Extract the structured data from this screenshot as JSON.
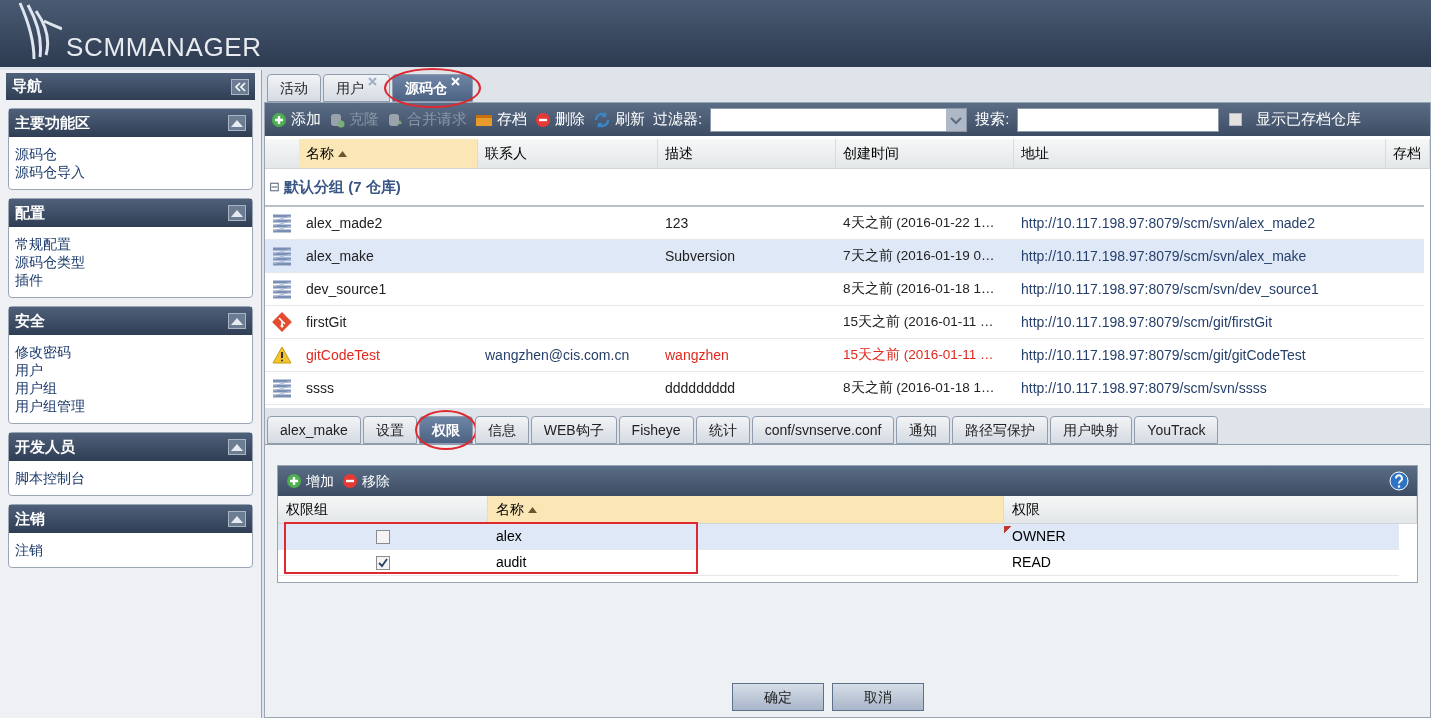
{
  "logo": "SCMMANAGER",
  "nav": {
    "title": "导航",
    "sections": [
      {
        "title": "主要功能区",
        "items": [
          "源码仓",
          "源码仓导入"
        ]
      },
      {
        "title": "配置",
        "items": [
          "常规配置",
          "源码仓类型",
          "插件"
        ]
      },
      {
        "title": "安全",
        "items": [
          "修改密码",
          "用户",
          "用户组",
          "用户组管理"
        ]
      },
      {
        "title": "开发人员",
        "items": [
          "脚本控制台"
        ]
      },
      {
        "title": "注销",
        "items": [
          "注销"
        ]
      }
    ]
  },
  "tabs": [
    {
      "label": "活动",
      "selected": false,
      "closable": false,
      "circled": false
    },
    {
      "label": "用户",
      "selected": false,
      "closable": true,
      "circled": false
    },
    {
      "label": "源码仓",
      "selected": true,
      "closable": true,
      "circled": true
    }
  ],
  "toolbar": {
    "buttons": [
      {
        "label": "添加",
        "kind": "add",
        "disabled": false
      },
      {
        "label": "克隆",
        "kind": "clone",
        "disabled": true
      },
      {
        "label": "合并请求",
        "kind": "merge",
        "disabled": true
      },
      {
        "label": "存档",
        "kind": "archive",
        "disabled": false
      },
      {
        "label": "删除",
        "kind": "delete",
        "disabled": false
      },
      {
        "label": "刷新",
        "kind": "refresh",
        "disabled": false
      }
    ],
    "filter_label": "过滤器:",
    "search_label": "搜索:",
    "show_archived": {
      "label": "显示已存档仓库",
      "checked": false
    }
  },
  "table": {
    "columns": [
      {
        "label": "名称",
        "sorted": true
      },
      {
        "label": "联系人",
        "sorted": false
      },
      {
        "label": "描述",
        "sorted": false
      },
      {
        "label": "创建时间",
        "sorted": false
      },
      {
        "label": "地址",
        "sorted": false
      },
      {
        "label": "存档",
        "sorted": false
      }
    ],
    "group": {
      "symbol": "⊟",
      "label": "默认分组 (7 仓库)"
    },
    "rows": [
      {
        "kind": "svn",
        "name": "alex_made2",
        "contact": "",
        "description": "123",
        "created": "4天之前 (2016-01-22 1…",
        "url": "http://10.117.198.97:8079/scm/svn/alex_made2",
        "selected": false,
        "error": false
      },
      {
        "kind": "svn",
        "name": "alex_make",
        "contact": "",
        "description": "Subversion",
        "created": "7天之前 (2016-01-19 0…",
        "url": "http://10.117.198.97:8079/scm/svn/alex_make",
        "selected": true,
        "error": false
      },
      {
        "kind": "svn",
        "name": "dev_source1",
        "contact": "",
        "description": "",
        "created": "8天之前 (2016-01-18 1…",
        "url": "http://10.117.198.97:8079/scm/svn/dev_source1",
        "selected": false,
        "error": false
      },
      {
        "kind": "git",
        "name": "firstGit",
        "contact": "",
        "description": "",
        "created": "15天之前 (2016-01-11 …",
        "url": "http://10.117.198.97:8079/scm/git/firstGit",
        "selected": false,
        "error": false
      },
      {
        "kind": "warning",
        "name": "gitCodeTest",
        "contact": "wangzhen@cis.com.cn",
        "description": "wangzhen",
        "created": "15天之前 (2016-01-11 …",
        "url": "http://10.117.198.97:8079/scm/git/gitCodeTest",
        "selected": false,
        "error": true
      },
      {
        "kind": "svn",
        "name": "ssss",
        "contact": "",
        "description": "ddddddddd",
        "created": "8天之前 (2016-01-18 1…",
        "url": "http://10.117.198.97:8079/scm/svn/ssss",
        "selected": false,
        "error": false
      }
    ]
  },
  "detail_tabs": [
    {
      "label": "alex_make",
      "selected": false,
      "circled": false
    },
    {
      "label": "设置",
      "selected": false,
      "circled": false
    },
    {
      "label": "权限",
      "selected": true,
      "circled": true
    },
    {
      "label": "信息",
      "selected": false,
      "circled": false
    },
    {
      "label": "WEB钩子",
      "selected": false,
      "circled": false
    },
    {
      "label": "Fisheye",
      "selected": false,
      "circled": false
    },
    {
      "label": "统计",
      "selected": false,
      "circled": false
    },
    {
      "label": "conf/svnserve.conf",
      "selected": false,
      "circled": false
    },
    {
      "label": "通知",
      "selected": false,
      "circled": false
    },
    {
      "label": "路径写保护",
      "selected": false,
      "circled": false
    },
    {
      "label": "用户映射",
      "selected": false,
      "circled": false
    },
    {
      "label": "YouTrack",
      "selected": false,
      "circled": false
    }
  ],
  "permissions": {
    "buttons": [
      {
        "label": "增加",
        "kind": "add"
      },
      {
        "label": "移除",
        "kind": "delete"
      }
    ],
    "columns": [
      {
        "label": "权限组",
        "sorted": false
      },
      {
        "label": "名称",
        "sorted": true
      },
      {
        "label": "权限",
        "sorted": false
      }
    ],
    "rows": [
      {
        "group": false,
        "name": "alex",
        "permission": "OWNER",
        "selected": true,
        "dirty": true
      },
      {
        "group": true,
        "name": "audit",
        "permission": "READ",
        "selected": false,
        "dirty": false
      }
    ]
  },
  "dialog_buttons": [
    "确定",
    "取消"
  ]
}
